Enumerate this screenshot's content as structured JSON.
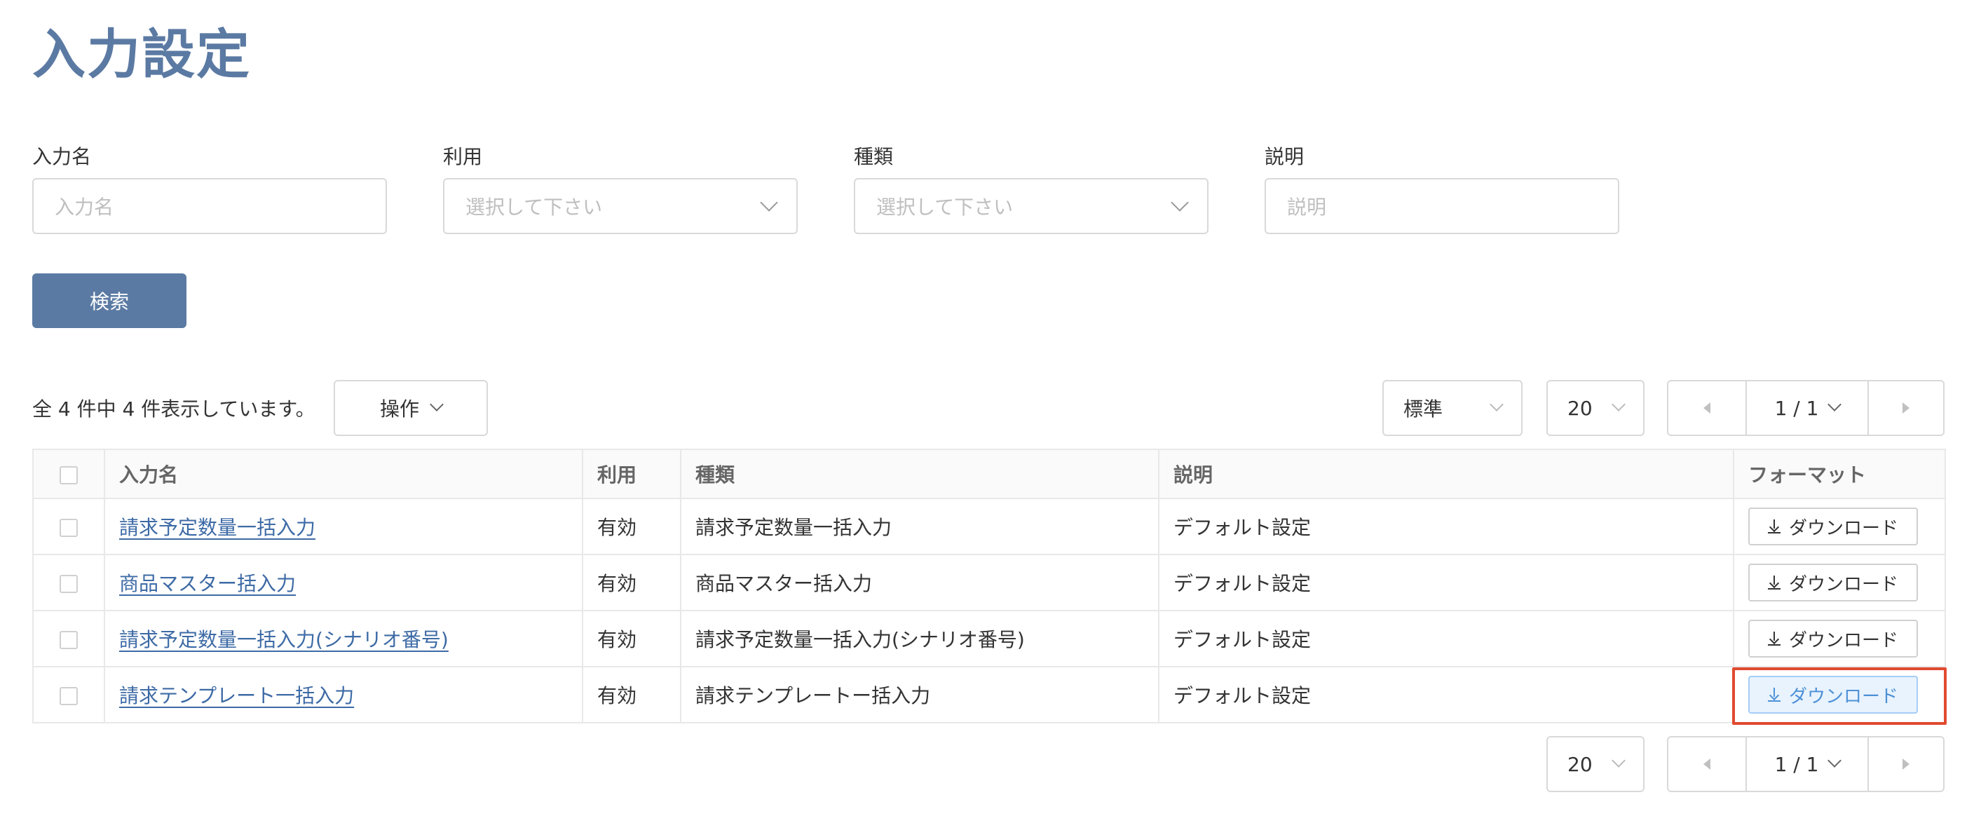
{
  "page": {
    "title": "入力設定"
  },
  "filters": {
    "name": {
      "label": "入力名",
      "placeholder": "入力名"
    },
    "usage": {
      "label": "利用",
      "placeholder": "選択して下さい"
    },
    "type": {
      "label": "種類",
      "placeholder": "選択して下さい"
    },
    "description": {
      "label": "説明",
      "placeholder": "説明"
    }
  },
  "search_button": {
    "label": "検索"
  },
  "toolbar": {
    "result_count": "全 4 件中 4 件表示しています。",
    "actions_label": "操作",
    "view_select": "標準",
    "page_size": "20",
    "pager_label": "1 / 1"
  },
  "table": {
    "headers": {
      "name": "入力名",
      "usage": "利用",
      "type": "種類",
      "description": "説明",
      "format": "フォーマット"
    },
    "rows": [
      {
        "name": "請求予定数量一括入力",
        "usage": "有効",
        "type": "請求予定数量一括入力",
        "description": "デフォルト設定",
        "download": "ダウンロード"
      },
      {
        "name": "商品マスター括入力",
        "usage": "有効",
        "type": "商品マスター括入力",
        "description": "デフォルト設定",
        "download": "ダウンロード"
      },
      {
        "name": "請求予定数量一括入力(シナリオ番号)",
        "usage": "有効",
        "type": "請求予定数量一括入力(シナリオ番号)",
        "description": "デフォルト設定",
        "download": "ダウンロード"
      },
      {
        "name": "請求テンプレート一括入力",
        "usage": "有効",
        "type": "請求テンプレートー括入力",
        "description": "デフォルト設定",
        "download": "ダウンロード"
      }
    ]
  },
  "bottom_pager": {
    "page_size": "20",
    "pager_label": "1 / 1"
  },
  "colors": {
    "accent": "#5b7aa3",
    "link": "#3d6aa5",
    "highlight": "#e04a2f",
    "active_button_bg": "#e8f3fe"
  }
}
